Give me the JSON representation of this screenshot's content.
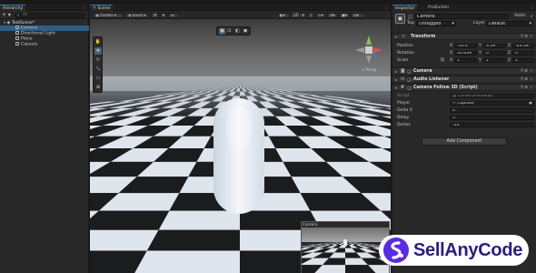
{
  "hierarchy": {
    "tab": "Hierarchy",
    "search_placeholder": "All",
    "scene_root": "TestScene*",
    "items": [
      "Camera",
      "Directional Light",
      "Plane",
      "Capsule"
    ]
  },
  "scene": {
    "tab": "Scene",
    "toolbar": {
      "pivot_label": "Center",
      "space_label": "Local",
      "persp_label": "< Persp"
    },
    "preview_title": "Camera"
  },
  "inspector": {
    "tabs": [
      "Inspector",
      "ProBuilder"
    ],
    "object_name": "Camera",
    "static_label": "Static",
    "tag_label": "Tag",
    "tag_value": "Untagged",
    "layer_label": "Layer",
    "layer_value": "Default",
    "transform": {
      "title": "Transform",
      "position_label": "Position",
      "rotation_label": "Rotation",
      "scale_label": "Scale",
      "axis_x": "X",
      "axis_y": "Y",
      "axis_z": "Z",
      "position": [
        "-54.4",
        "3.59",
        "-23.18"
      ],
      "rotation": [
        "10.639",
        "0",
        "0"
      ],
      "scale": [
        "1",
        "1",
        "1"
      ]
    },
    "camera_title": "Camera",
    "audio_title": "Audio Listener",
    "follow": {
      "title": "Camera Follow 3D (Script)",
      "script_label": "Script",
      "script_value": "CameraFollow3D",
      "player_label": "Player",
      "player_value": "Capsule",
      "deltax_label": "Delta X",
      "deltax_value": "0",
      "deltay_label": "Delay",
      "deltay_value": "5",
      "deltaz_label": "Deltaz",
      "deltaz_value": "-10"
    },
    "add_component": "Add Component"
  },
  "watermark": {
    "text": "SellAnyCode"
  }
}
